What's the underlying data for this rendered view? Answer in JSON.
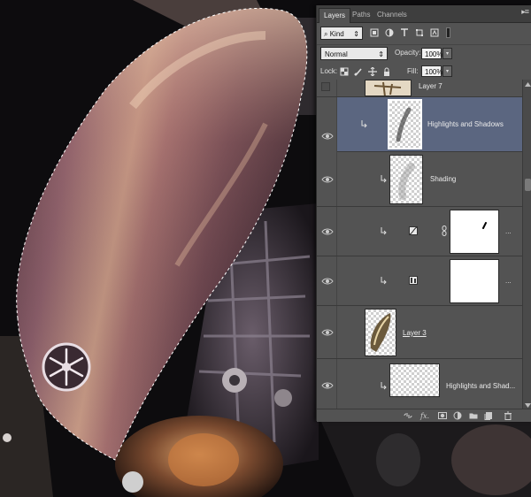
{
  "panel": {
    "tabs": [
      {
        "label": "Layers",
        "active": true
      },
      {
        "label": "Paths",
        "active": false
      },
      {
        "label": "Channels",
        "active": false
      }
    ],
    "menu_glyph": "▸≡",
    "filter": {
      "kind_label": "Kind"
    },
    "blend_mode": "Normal",
    "opacity_label": "Opacity:",
    "opacity_value": "100%",
    "lock_label": "Lock:",
    "fill_label": "Fill:",
    "fill_value": "100%"
  },
  "layers": [
    {
      "name": "Layer 7",
      "visible": false,
      "selected": false,
      "clipped": false
    },
    {
      "name": "Highlights and Shadows",
      "visible": true,
      "selected": true,
      "clipped": true
    },
    {
      "name": "Shading",
      "visible": true,
      "selected": false,
      "clipped": true
    },
    {
      "name": "",
      "visible": true,
      "selected": false,
      "clipped": true,
      "type": "curves-adjustment",
      "dots": "..."
    },
    {
      "name": "",
      "visible": true,
      "selected": false,
      "clipped": true,
      "type": "channel-mixer-adjustment",
      "dots": "..."
    },
    {
      "name": "Layer 3",
      "visible": true,
      "selected": false,
      "clipped": false
    },
    {
      "name": "Highlights and Shad...",
      "visible": true,
      "selected": false,
      "clipped": true
    }
  ],
  "colors": {
    "panel_bg": "#535353",
    "selected_row": "#5b6680",
    "tab_bar": "#3e3e3e",
    "canvas_bg": "#0c0b0c",
    "fender_metal": "#8a5f6d"
  },
  "icons": [
    "eye-icon",
    "chain-link-icon",
    "curves-icon",
    "channel-mixer-icon",
    "link-layers-icon",
    "fx-icon",
    "add-mask-icon",
    "adjustment-layer-icon",
    "new-group-icon",
    "new-layer-icon",
    "trash-icon"
  ]
}
